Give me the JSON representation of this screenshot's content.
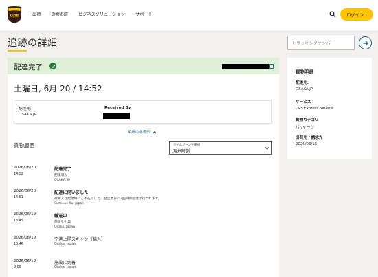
{
  "nav": {
    "links": [
      "出荷",
      "貨物追跡",
      "ビジネスソリューション",
      "サポート"
    ],
    "login_label": "ログイン ›",
    "logo_text": "ups"
  },
  "header": {
    "title": "追跡の詳細"
  },
  "tracking": {
    "placeholder": "トラッキングナンバー"
  },
  "status": {
    "label": "配達完了",
    "delivered_at": "土曜日, 6月 20 / 14:52"
  },
  "delivery_info": {
    "ship_to_label": "配達先:",
    "ship_to_value": "OSAKA JP",
    "received_by_label": "Received By"
  },
  "details_toggle": "明細の非表示",
  "history": {
    "title": "貨物履歴",
    "tz_label": "タイムゾーンを選択",
    "tz_value": "現地時刻",
    "events": [
      {
        "date": "2026/06/20",
        "time": "14:52",
        "title": "配達完了",
        "desc": "配達済み",
        "loc": "OSAKA, JP",
        "bold": true
      },
      {
        "date": "2026/06/20",
        "time": "14:51",
        "title": "配達に伺いました",
        "desc": "荷受人は配達時にご不在でした。翌営業日に2回目の配達が行われます。",
        "loc": "Suminoe-Ku, Japan",
        "bold": true
      },
      {
        "date": "2026/06/19",
        "time": "18:45",
        "title": "輸送中",
        "desc": "施設を出発",
        "loc": "Osaka, Japan",
        "bold": true
      },
      {
        "date": "2026/06/19",
        "time": "10:46",
        "title": "空港上屋スキャン（輸入）",
        "desc": "Osaka, Japan",
        "loc": "",
        "bold": false
      },
      {
        "date": "2026/06/19",
        "time": "9:08",
        "title": "施設に到着",
        "desc": "Osaka, Japan",
        "loc": "",
        "bold": false
      }
    ]
  },
  "shipment": {
    "title": "貨物明細",
    "items": [
      {
        "label": "配達先:",
        "value": "OSAKA JP"
      },
      {
        "label": "サービス",
        "value": "UPS Express Saver®"
      },
      {
        "label": "貨物カテゴリ",
        "value": "パッケージ"
      },
      {
        "label": "出荷先 / 請求先",
        "value": "2026/06/16"
      }
    ]
  },
  "colors": {
    "brand_gold": "#ffc400",
    "brand_brown": "#351c15",
    "status_green": "#dff0d8",
    "link_blue": "#1a5f86"
  }
}
